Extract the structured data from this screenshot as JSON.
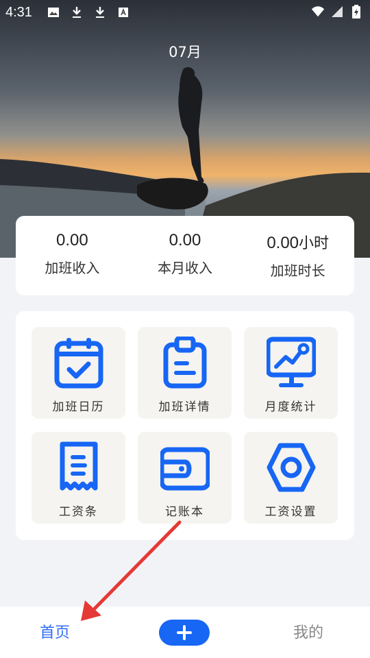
{
  "status_bar": {
    "time": "4:31",
    "left_icons": [
      "image-icon",
      "download-icon",
      "download-icon",
      "text-a-icon"
    ],
    "right_icons": [
      "wifi-icon",
      "signal-icon",
      "battery-icon"
    ]
  },
  "header": {
    "month": "07月"
  },
  "stats": [
    {
      "value": "0.00",
      "unit": "",
      "label": "加班收入"
    },
    {
      "value": "0.00",
      "unit": "",
      "label": "本月收入"
    },
    {
      "value": "0.00",
      "unit": "小时",
      "label": "加班时长"
    }
  ],
  "grid": [
    {
      "label": "加班日历",
      "icon": "calendar-icon"
    },
    {
      "label": "加班详情",
      "icon": "clipboard-icon"
    },
    {
      "label": "月度统计",
      "icon": "chart-board-icon"
    },
    {
      "label": "工资条",
      "icon": "receipt-icon"
    },
    {
      "label": "记账本",
      "icon": "wallet-icon"
    },
    {
      "label": "工资设置",
      "icon": "settings-hex-icon"
    }
  ],
  "bottom_nav": {
    "home": "首页",
    "add": "+",
    "mine": "我的"
  },
  "colors": {
    "accent": "#1766f4",
    "active_nav": "#2f6df6",
    "inactive_nav": "#888888",
    "annotation_arrow": "#e53935"
  }
}
